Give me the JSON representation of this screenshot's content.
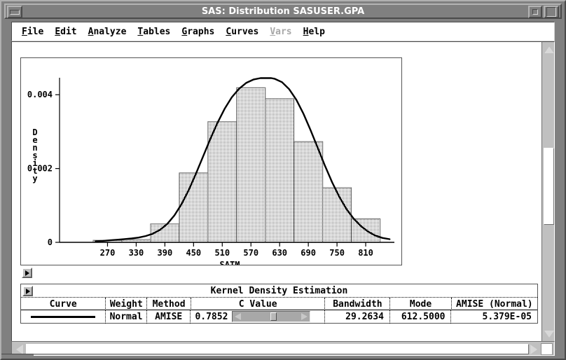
{
  "window": {
    "title": "SAS: Distribution SASUSER.GPA",
    "minimize_icon": "minimize-icon",
    "restore_icon": "restore-icon",
    "maximize_icon": "maximize-icon"
  },
  "menubar": {
    "items": [
      {
        "label": "File",
        "mnemonic": "F",
        "disabled": false
      },
      {
        "label": "Edit",
        "mnemonic": "E",
        "disabled": false
      },
      {
        "label": "Analyze",
        "mnemonic": "A",
        "disabled": false
      },
      {
        "label": "Tables",
        "mnemonic": "T",
        "disabled": false
      },
      {
        "label": "Graphs",
        "mnemonic": "G",
        "disabled": false
      },
      {
        "label": "Curves",
        "mnemonic": "C",
        "disabled": false
      },
      {
        "label": "Vars",
        "mnemonic": "V",
        "disabled": true
      },
      {
        "label": "Help",
        "mnemonic": "H",
        "disabled": false
      }
    ]
  },
  "plot": {
    "expand_icon": "expand-triangle-icon"
  },
  "kde_table": {
    "expand_icon": "expand-triangle-icon",
    "title": "Kernel Density Estimation",
    "headers": [
      "Curve",
      "Weight",
      "Method",
      "C Value",
      "Bandwidth",
      "Mode",
      "AMISE (Normal)"
    ],
    "row": {
      "curve": "",
      "weight": "Normal",
      "method": "AMISE",
      "c_value": "0.7852",
      "bandwidth": "29.2634",
      "mode": "612.5000",
      "amise_normal": "5.379E-05"
    },
    "slider": {
      "left_arrow_icon": "slider-left-arrow-icon",
      "right_arrow_icon": "slider-right-arrow-icon",
      "thumb_icon": "slider-thumb"
    }
  },
  "scrollbars": {
    "vertical": {
      "up_icon": "scroll-up-arrow-icon",
      "down_icon": "scroll-down-arrow-icon"
    },
    "horizontal": {
      "left_icon": "scroll-left-arrow-icon",
      "right_icon": "scroll-right-arrow-icon"
    }
  },
  "colors": {
    "chrome": "#808080",
    "face": "#c0c0c0",
    "client": "#ffffff",
    "ink": "#000000",
    "disabled_text": "#a8a8a8"
  },
  "chart_data": {
    "type": "bar",
    "title": "",
    "xlabel": "SATM",
    "ylabel": "Density",
    "xlim": [
      240,
      870
    ],
    "ylim": [
      0,
      0.00465
    ],
    "grid": false,
    "legend": false,
    "xticks": [
      270,
      330,
      390,
      450,
      510,
      570,
      630,
      690,
      750,
      810
    ],
    "yticks": [
      0,
      0.002,
      0.004
    ],
    "ytick_labels": [
      "0",
      "0.002",
      "0.004"
    ],
    "bin_width": 60,
    "bin_edges": [
      240,
      300,
      360,
      420,
      480,
      540,
      600,
      660,
      720,
      780,
      840
    ],
    "categories": [
      "240-300",
      "300-360",
      "360-420",
      "420-480",
      "480-540",
      "540-600",
      "600-660",
      "660-720",
      "720-780",
      "780-840"
    ],
    "values": [
      5.5e-05,
      7.5e-05,
      0.0005,
      0.00188,
      0.00327,
      0.00419,
      0.00389,
      0.00273,
      0.00148,
      0.00064
    ],
    "series": [
      {
        "name": "Histogram",
        "type": "bar",
        "values": [
          5.5e-05,
          7.5e-05,
          0.0005,
          0.00188,
          0.00327,
          0.00419,
          0.00389,
          0.00273,
          0.00148,
          0.00064
        ]
      },
      {
        "name": "Kernel Density (Normal, c=0.7852)",
        "type": "line",
        "x": [
          245,
          260,
          275,
          290,
          305,
          320,
          335,
          350,
          365,
          380,
          395,
          410,
          425,
          440,
          455,
          470,
          485,
          500,
          515,
          530,
          545,
          560,
          575,
          590,
          605,
          612.5,
          620,
          635,
          650,
          665,
          680,
          695,
          710,
          725,
          740,
          755,
          770,
          785,
          800,
          815,
          830,
          845,
          860
        ],
        "y": [
          3e-05,
          4e-05,
          5.5e-05,
          7e-05,
          8.5e-05,
          0.000105,
          0.00013,
          0.00017,
          0.000235,
          0.00034,
          0.0005,
          0.00073,
          0.00104,
          0.00142,
          0.00186,
          0.00233,
          0.0028,
          0.00324,
          0.00362,
          0.00393,
          0.00416,
          0.00432,
          0.00441,
          0.00445,
          0.00445,
          0.00445,
          0.00443,
          0.00434,
          0.00415,
          0.00386,
          0.00348,
          0.00303,
          0.00255,
          0.00207,
          0.00162,
          0.00123,
          0.0009,
          0.00064,
          0.00044,
          0.00029,
          0.000185,
          0.00012,
          8.5e-05
        ]
      }
    ]
  }
}
